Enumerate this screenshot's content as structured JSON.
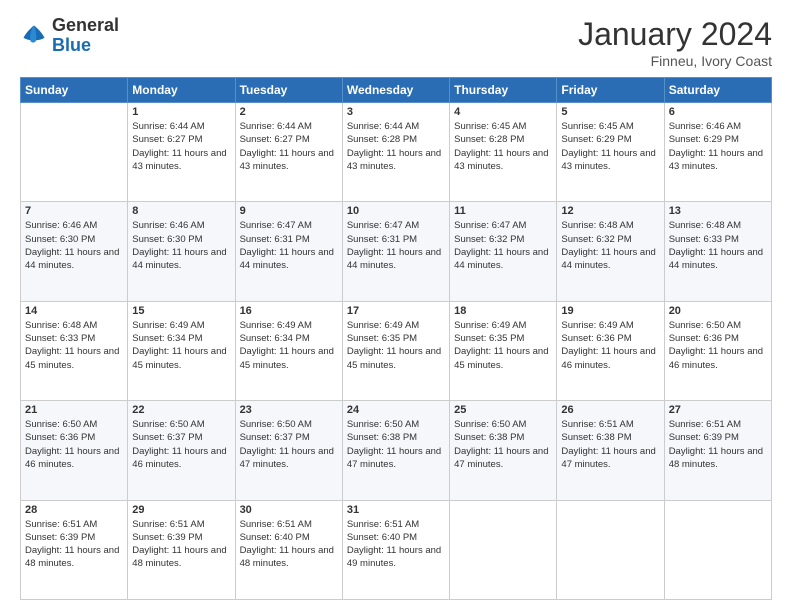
{
  "header": {
    "logo": {
      "general": "General",
      "blue": "Blue"
    },
    "title": "January 2024",
    "location": "Finneu, Ivory Coast"
  },
  "weekdays": [
    "Sunday",
    "Monday",
    "Tuesday",
    "Wednesday",
    "Thursday",
    "Friday",
    "Saturday"
  ],
  "weeks": [
    [
      {
        "day": "",
        "sunrise": "",
        "sunset": "",
        "daylight": ""
      },
      {
        "day": "1",
        "sunrise": "Sunrise: 6:44 AM",
        "sunset": "Sunset: 6:27 PM",
        "daylight": "Daylight: 11 hours and 43 minutes."
      },
      {
        "day": "2",
        "sunrise": "Sunrise: 6:44 AM",
        "sunset": "Sunset: 6:27 PM",
        "daylight": "Daylight: 11 hours and 43 minutes."
      },
      {
        "day": "3",
        "sunrise": "Sunrise: 6:44 AM",
        "sunset": "Sunset: 6:28 PM",
        "daylight": "Daylight: 11 hours and 43 minutes."
      },
      {
        "day": "4",
        "sunrise": "Sunrise: 6:45 AM",
        "sunset": "Sunset: 6:28 PM",
        "daylight": "Daylight: 11 hours and 43 minutes."
      },
      {
        "day": "5",
        "sunrise": "Sunrise: 6:45 AM",
        "sunset": "Sunset: 6:29 PM",
        "daylight": "Daylight: 11 hours and 43 minutes."
      },
      {
        "day": "6",
        "sunrise": "Sunrise: 6:46 AM",
        "sunset": "Sunset: 6:29 PM",
        "daylight": "Daylight: 11 hours and 43 minutes."
      }
    ],
    [
      {
        "day": "7",
        "sunrise": "Sunrise: 6:46 AM",
        "sunset": "Sunset: 6:30 PM",
        "daylight": "Daylight: 11 hours and 44 minutes."
      },
      {
        "day": "8",
        "sunrise": "Sunrise: 6:46 AM",
        "sunset": "Sunset: 6:30 PM",
        "daylight": "Daylight: 11 hours and 44 minutes."
      },
      {
        "day": "9",
        "sunrise": "Sunrise: 6:47 AM",
        "sunset": "Sunset: 6:31 PM",
        "daylight": "Daylight: 11 hours and 44 minutes."
      },
      {
        "day": "10",
        "sunrise": "Sunrise: 6:47 AM",
        "sunset": "Sunset: 6:31 PM",
        "daylight": "Daylight: 11 hours and 44 minutes."
      },
      {
        "day": "11",
        "sunrise": "Sunrise: 6:47 AM",
        "sunset": "Sunset: 6:32 PM",
        "daylight": "Daylight: 11 hours and 44 minutes."
      },
      {
        "day": "12",
        "sunrise": "Sunrise: 6:48 AM",
        "sunset": "Sunset: 6:32 PM",
        "daylight": "Daylight: 11 hours and 44 minutes."
      },
      {
        "day": "13",
        "sunrise": "Sunrise: 6:48 AM",
        "sunset": "Sunset: 6:33 PM",
        "daylight": "Daylight: 11 hours and 44 minutes."
      }
    ],
    [
      {
        "day": "14",
        "sunrise": "Sunrise: 6:48 AM",
        "sunset": "Sunset: 6:33 PM",
        "daylight": "Daylight: 11 hours and 45 minutes."
      },
      {
        "day": "15",
        "sunrise": "Sunrise: 6:49 AM",
        "sunset": "Sunset: 6:34 PM",
        "daylight": "Daylight: 11 hours and 45 minutes."
      },
      {
        "day": "16",
        "sunrise": "Sunrise: 6:49 AM",
        "sunset": "Sunset: 6:34 PM",
        "daylight": "Daylight: 11 hours and 45 minutes."
      },
      {
        "day": "17",
        "sunrise": "Sunrise: 6:49 AM",
        "sunset": "Sunset: 6:35 PM",
        "daylight": "Daylight: 11 hours and 45 minutes."
      },
      {
        "day": "18",
        "sunrise": "Sunrise: 6:49 AM",
        "sunset": "Sunset: 6:35 PM",
        "daylight": "Daylight: 11 hours and 45 minutes."
      },
      {
        "day": "19",
        "sunrise": "Sunrise: 6:49 AM",
        "sunset": "Sunset: 6:36 PM",
        "daylight": "Daylight: 11 hours and 46 minutes."
      },
      {
        "day": "20",
        "sunrise": "Sunrise: 6:50 AM",
        "sunset": "Sunset: 6:36 PM",
        "daylight": "Daylight: 11 hours and 46 minutes."
      }
    ],
    [
      {
        "day": "21",
        "sunrise": "Sunrise: 6:50 AM",
        "sunset": "Sunset: 6:36 PM",
        "daylight": "Daylight: 11 hours and 46 minutes."
      },
      {
        "day": "22",
        "sunrise": "Sunrise: 6:50 AM",
        "sunset": "Sunset: 6:37 PM",
        "daylight": "Daylight: 11 hours and 46 minutes."
      },
      {
        "day": "23",
        "sunrise": "Sunrise: 6:50 AM",
        "sunset": "Sunset: 6:37 PM",
        "daylight": "Daylight: 11 hours and 47 minutes."
      },
      {
        "day": "24",
        "sunrise": "Sunrise: 6:50 AM",
        "sunset": "Sunset: 6:38 PM",
        "daylight": "Daylight: 11 hours and 47 minutes."
      },
      {
        "day": "25",
        "sunrise": "Sunrise: 6:50 AM",
        "sunset": "Sunset: 6:38 PM",
        "daylight": "Daylight: 11 hours and 47 minutes."
      },
      {
        "day": "26",
        "sunrise": "Sunrise: 6:51 AM",
        "sunset": "Sunset: 6:38 PM",
        "daylight": "Daylight: 11 hours and 47 minutes."
      },
      {
        "day": "27",
        "sunrise": "Sunrise: 6:51 AM",
        "sunset": "Sunset: 6:39 PM",
        "daylight": "Daylight: 11 hours and 48 minutes."
      }
    ],
    [
      {
        "day": "28",
        "sunrise": "Sunrise: 6:51 AM",
        "sunset": "Sunset: 6:39 PM",
        "daylight": "Daylight: 11 hours and 48 minutes."
      },
      {
        "day": "29",
        "sunrise": "Sunrise: 6:51 AM",
        "sunset": "Sunset: 6:39 PM",
        "daylight": "Daylight: 11 hours and 48 minutes."
      },
      {
        "day": "30",
        "sunrise": "Sunrise: 6:51 AM",
        "sunset": "Sunset: 6:40 PM",
        "daylight": "Daylight: 11 hours and 48 minutes."
      },
      {
        "day": "31",
        "sunrise": "Sunrise: 6:51 AM",
        "sunset": "Sunset: 6:40 PM",
        "daylight": "Daylight: 11 hours and 49 minutes."
      },
      {
        "day": "",
        "sunrise": "",
        "sunset": "",
        "daylight": ""
      },
      {
        "day": "",
        "sunrise": "",
        "sunset": "",
        "daylight": ""
      },
      {
        "day": "",
        "sunrise": "",
        "sunset": "",
        "daylight": ""
      }
    ]
  ]
}
